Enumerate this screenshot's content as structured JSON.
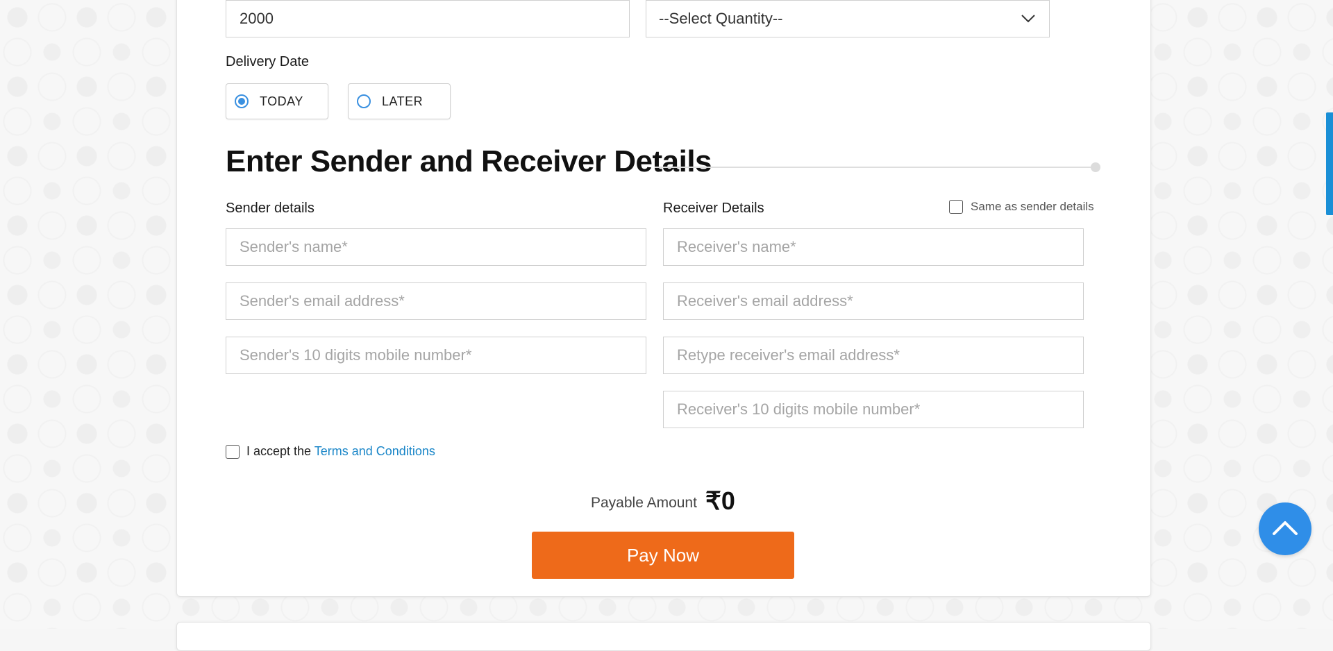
{
  "amount_input": {
    "value": "2000"
  },
  "quantity_select": {
    "selected": "--Select Quantity--"
  },
  "delivery": {
    "label": "Delivery Date",
    "options": [
      {
        "label": "TODAY",
        "checked": true
      },
      {
        "label": "LATER",
        "checked": false
      }
    ]
  },
  "section": {
    "title": "Enter Sender and Receiver Details"
  },
  "sender": {
    "heading": "Sender details",
    "name_placeholder": "Sender's name*",
    "email_placeholder": "Sender's email address*",
    "mobile_placeholder": "Sender's 10 digits mobile number*"
  },
  "receiver": {
    "heading": "Receiver Details",
    "same_as_sender_label": "Same as sender details",
    "name_placeholder": "Receiver's name*",
    "email_placeholder": "Receiver's email address*",
    "retype_email_placeholder": "Retype receiver's email address*",
    "mobile_placeholder": "Receiver's 10 digits mobile number*"
  },
  "terms": {
    "prefix": "I accept the",
    "link_text": "Terms and Conditions"
  },
  "payment": {
    "label": "Payable Amount",
    "currency_symbol": "₹",
    "amount": "0",
    "button_label": "Pay Now"
  },
  "colors": {
    "accent_orange": "#ee6a1a",
    "link_blue": "#1a86c8",
    "radio_blue": "#3a90e0",
    "scroll_button_blue": "#2f8ee8"
  },
  "icons": {
    "select_arrow": "chevron-down-icon",
    "scroll_top": "chevron-up-icon"
  }
}
